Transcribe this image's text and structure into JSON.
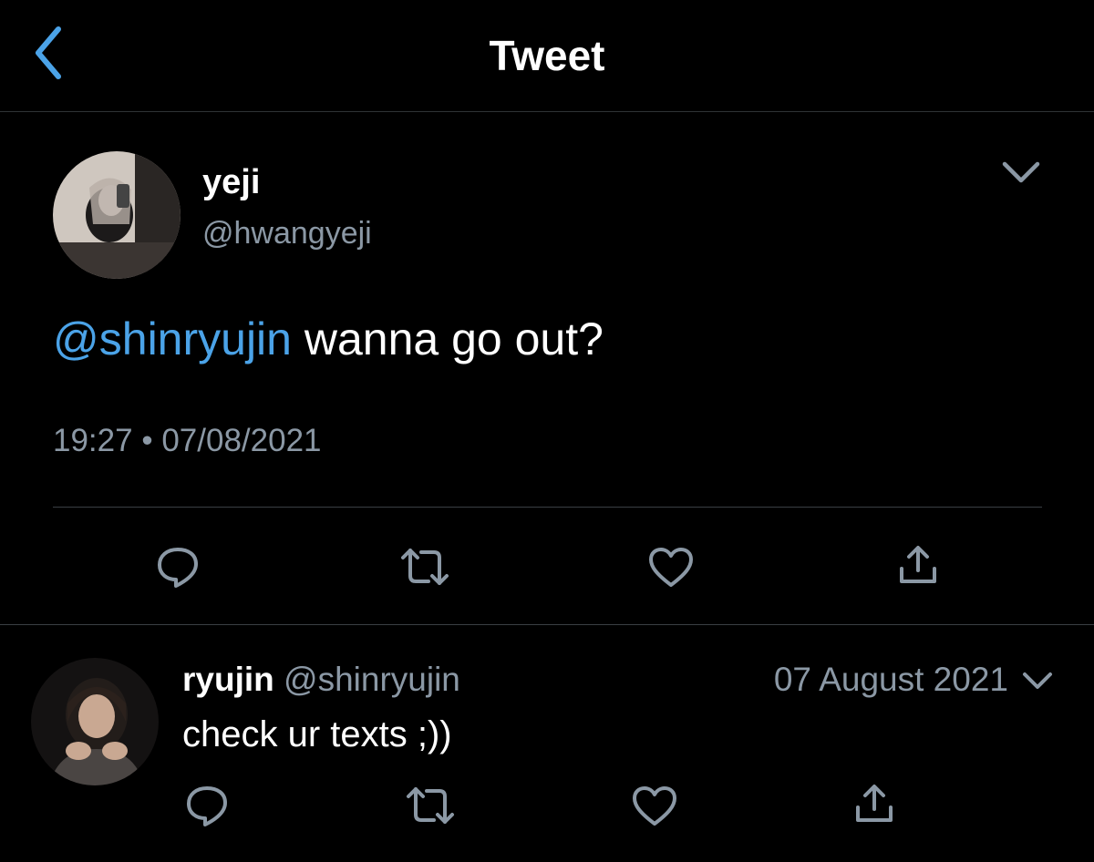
{
  "header": {
    "title": "Tweet"
  },
  "tweet": {
    "name": "yeji",
    "handle": "@hwangyeji",
    "mention": "@shinryujin",
    "text": " wanna go out?",
    "time": "19:27",
    "separator": "•",
    "date": "07/08/2021"
  },
  "reply": {
    "name": "ryujin",
    "handle": "@shinryujin",
    "date": "07 August 2021",
    "text": "check ur texts ;))"
  },
  "icons": [
    "back-icon",
    "chevron-down-icon",
    "reply-icon",
    "retweet-icon",
    "like-icon",
    "share-icon"
  ],
  "colors": {
    "background": "#000000",
    "accent": "#4ba3e8",
    "secondary_text": "#8b98a5",
    "divider": "#3a3f44"
  }
}
